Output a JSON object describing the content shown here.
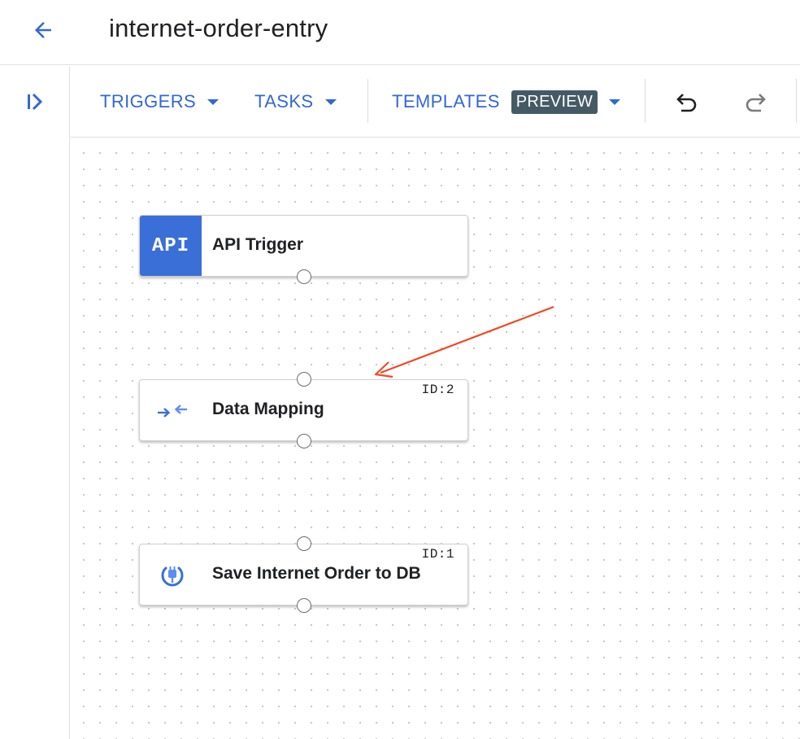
{
  "header": {
    "title": "internet-order-entry"
  },
  "toolbar": {
    "triggers_label": "TRIGGERS",
    "tasks_label": "TASKS",
    "templates_label": "TEMPLATES",
    "preview_badge": "PREVIEW"
  },
  "nodes": [
    {
      "label": "API Trigger",
      "badge": "API",
      "icon": "api-badge"
    },
    {
      "label": "Data Mapping",
      "id": "ID:2",
      "icon": "data-mapping-icon"
    },
    {
      "label": "Save Internet Order to DB",
      "id": "ID:1",
      "icon": "connector-plug-icon"
    }
  ],
  "colors": {
    "accent": "#3367d6",
    "api_badge": "#3a6fd8",
    "preview_badge": "#455a64",
    "annotation_arrow": "#f04a23"
  }
}
